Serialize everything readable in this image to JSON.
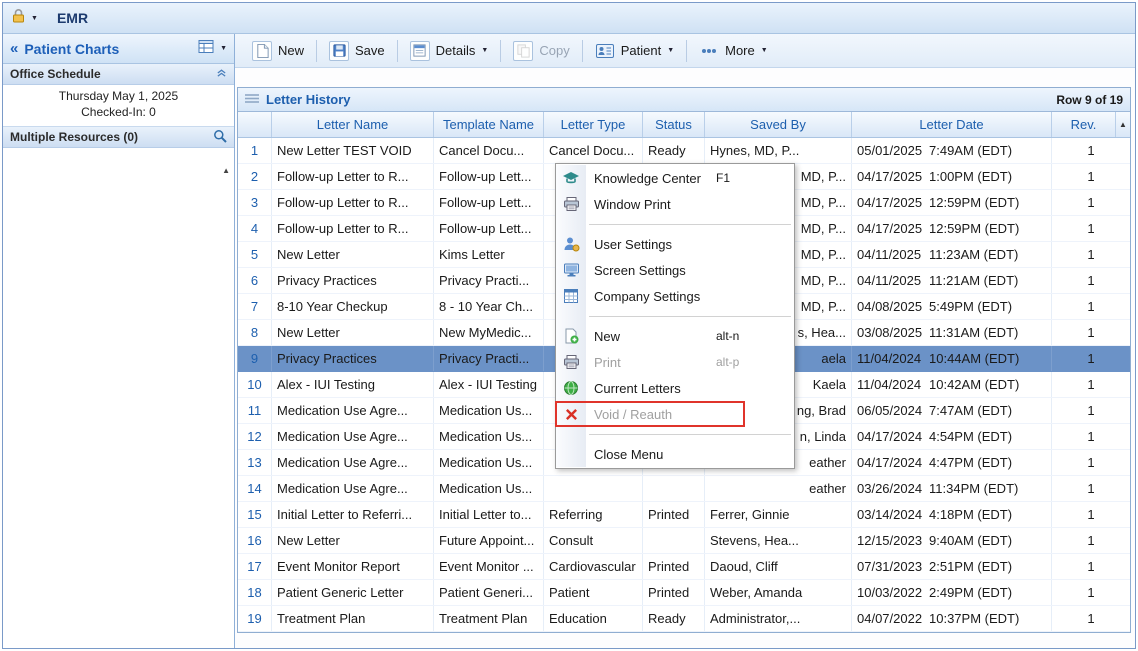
{
  "topbar": {
    "title": "EMR"
  },
  "sidebar": {
    "title": "Patient Charts",
    "office_schedule": {
      "header": "Office Schedule",
      "date": "Thursday May 1, 2025",
      "checked_in": "Checked-In: 0"
    },
    "resources": {
      "label": "Multiple Resources (0)"
    }
  },
  "toolbar": {
    "buttons": [
      {
        "label": "New",
        "icon": "new-doc-icon",
        "caret": false,
        "disabled": false
      },
      {
        "label": "Save",
        "icon": "save-icon",
        "caret": false,
        "disabled": false
      },
      {
        "label": "Details",
        "icon": "details-icon",
        "caret": true,
        "disabled": false
      },
      {
        "label": "Copy",
        "icon": "copy-icon",
        "caret": false,
        "disabled": true
      },
      {
        "label": "Patient",
        "icon": "patient-icon",
        "caret": true,
        "disabled": false
      },
      {
        "label": "More",
        "icon": "more-dots-icon",
        "caret": true,
        "disabled": false
      }
    ]
  },
  "letter_history": {
    "title": "Letter History",
    "row_status": "Row 9 of 19",
    "columns": [
      "",
      "Letter Name",
      "Template Name",
      "Letter Type",
      "Status",
      "Saved By",
      "Letter Date",
      "Rev."
    ],
    "rows": [
      {
        "num": "1",
        "letter_name": "New Letter TEST VOID",
        "template_name": "Cancel Docu...",
        "letter_type": "Cancel Docu...",
        "status": "Ready",
        "saved_by": "Hynes, MD, P...",
        "saved_by_covered": false,
        "letter_date": "05/01/2025 7:49AM (EDT)",
        "rev": "1",
        "selected": false
      },
      {
        "num": "2",
        "letter_name": "Follow-up Letter to R...",
        "template_name": "Follow-up Lett...",
        "letter_type": "",
        "status": "",
        "saved_by": "MD, P...",
        "saved_by_covered": true,
        "letter_date": "04/17/2025 1:00PM (EDT)",
        "rev": "1",
        "selected": false
      },
      {
        "num": "3",
        "letter_name": "Follow-up Letter to R...",
        "template_name": "Follow-up Lett...",
        "letter_type": "",
        "status": "",
        "saved_by": "MD, P...",
        "saved_by_covered": true,
        "letter_date": "04/17/2025 12:59PM (EDT)",
        "rev": "1",
        "selected": false
      },
      {
        "num": "4",
        "letter_name": "Follow-up Letter to R...",
        "template_name": "Follow-up Lett...",
        "letter_type": "",
        "status": "",
        "saved_by": "MD, P...",
        "saved_by_covered": true,
        "letter_date": "04/17/2025 12:59PM (EDT)",
        "rev": "1",
        "selected": false
      },
      {
        "num": "5",
        "letter_name": "New Letter",
        "template_name": "Kims Letter",
        "letter_type": "",
        "status": "",
        "saved_by": "MD, P...",
        "saved_by_covered": true,
        "letter_date": "04/11/2025 11:23AM (EDT)",
        "rev": "1",
        "selected": false
      },
      {
        "num": "6",
        "letter_name": "Privacy Practices",
        "template_name": "Privacy Practi...",
        "letter_type": "",
        "status": "",
        "saved_by": "MD, P...",
        "saved_by_covered": true,
        "letter_date": "04/11/2025 11:21AM (EDT)",
        "rev": "1",
        "selected": false
      },
      {
        "num": "7",
        "letter_name": "8-10 Year Checkup",
        "template_name": "8 - 10 Year Ch...",
        "letter_type": "",
        "status": "",
        "saved_by": "MD, P...",
        "saved_by_covered": true,
        "letter_date": "04/08/2025 5:49PM (EDT)",
        "rev": "1",
        "selected": false
      },
      {
        "num": "8",
        "letter_name": "New Letter",
        "template_name": "New MyMedic...",
        "letter_type": "",
        "status": "",
        "saved_by": "s, Hea...",
        "saved_by_covered": true,
        "letter_date": "03/08/2025 11:31AM (EDT)",
        "rev": "1",
        "selected": false
      },
      {
        "num": "9",
        "letter_name": "Privacy Practices",
        "template_name": "Privacy Practi...",
        "letter_type": "",
        "status": "",
        "saved_by": "aela",
        "saved_by_covered": true,
        "letter_date": "11/04/2024 10:44AM (EDT)",
        "rev": "1",
        "selected": true
      },
      {
        "num": "10",
        "letter_name": "Alex - IUI Testing",
        "template_name": "Alex - IUI Testing",
        "letter_type": "",
        "status": "",
        "saved_by": "Kaela",
        "saved_by_covered": true,
        "letter_date": "11/04/2024 10:42AM (EDT)",
        "rev": "1",
        "selected": false
      },
      {
        "num": "11",
        "letter_name": "Medication Use Agre...",
        "template_name": "Medication Us...",
        "letter_type": "",
        "status": "",
        "saved_by": "ng, Brad",
        "saved_by_covered": true,
        "letter_date": "06/05/2024 7:47AM (EDT)",
        "rev": "1",
        "selected": false
      },
      {
        "num": "12",
        "letter_name": "Medication Use Agre...",
        "template_name": "Medication Us...",
        "letter_type": "",
        "status": "",
        "saved_by": "n, Linda",
        "saved_by_covered": true,
        "letter_date": "04/17/2024 4:54PM (EDT)",
        "rev": "1",
        "selected": false
      },
      {
        "num": "13",
        "letter_name": "Medication Use Agre...",
        "template_name": "Medication Us...",
        "letter_type": "",
        "status": "",
        "saved_by": "eather",
        "saved_by_covered": true,
        "letter_date": "04/17/2024 4:47PM (EDT)",
        "rev": "1",
        "selected": false
      },
      {
        "num": "14",
        "letter_name": "Medication Use Agre...",
        "template_name": "Medication Us...",
        "letter_type": "",
        "status": "",
        "saved_by": "eather",
        "saved_by_covered": true,
        "letter_date": "03/26/2024 11:34PM (EDT)",
        "rev": "1",
        "selected": false
      },
      {
        "num": "15",
        "letter_name": "Initial Letter to Referri...",
        "template_name": "Initial Letter to...",
        "letter_type": "Referring",
        "status": "Printed",
        "saved_by": "Ferrer, Ginnie",
        "saved_by_covered": false,
        "letter_date": "03/14/2024 4:18PM (EDT)",
        "rev": "1",
        "selected": false
      },
      {
        "num": "16",
        "letter_name": "New Letter",
        "template_name": "Future Appoint...",
        "letter_type": "Consult",
        "status": "",
        "saved_by": "Stevens, Hea...",
        "saved_by_covered": false,
        "letter_date": "12/15/2023 9:40AM (EDT)",
        "rev": "1",
        "selected": false
      },
      {
        "num": "17",
        "letter_name": "Event Monitor Report",
        "template_name": "Event Monitor ...",
        "letter_type": "Cardiovascular",
        "status": "Printed",
        "saved_by": "Daoud, Cliff",
        "saved_by_covered": false,
        "letter_date": "07/31/2023 2:51PM (EDT)",
        "rev": "1",
        "selected": false
      },
      {
        "num": "18",
        "letter_name": "Patient Generic Letter",
        "template_name": "Patient Generi...",
        "letter_type": "Patient",
        "status": "Printed",
        "saved_by": "Weber, Amanda",
        "saved_by_covered": false,
        "letter_date": "10/03/2022 2:49PM (EDT)",
        "rev": "1",
        "selected": false
      },
      {
        "num": "19",
        "letter_name": "Treatment Plan",
        "template_name": "Treatment Plan",
        "letter_type": "Education",
        "status": "Ready",
        "saved_by": "Administrator,...",
        "saved_by_covered": false,
        "letter_date": "04/07/2022 10:37PM (EDT)",
        "rev": "1",
        "selected": false
      }
    ]
  },
  "context_menu": {
    "items": [
      {
        "type": "item",
        "label": "Knowledge Center",
        "icon": "knowledge-center-icon",
        "shortcut": "F1",
        "disabled": false,
        "highlighted": false
      },
      {
        "type": "item",
        "label": "Window Print",
        "icon": "printer-icon",
        "shortcut": "",
        "disabled": false,
        "highlighted": false
      },
      {
        "type": "separator"
      },
      {
        "type": "item",
        "label": "User Settings",
        "icon": "user-settings-icon",
        "shortcut": "",
        "disabled": false,
        "highlighted": false
      },
      {
        "type": "item",
        "label": "Screen Settings",
        "icon": "screen-settings-icon",
        "shortcut": "",
        "disabled": false,
        "highlighted": false
      },
      {
        "type": "item",
        "label": "Company Settings",
        "icon": "company-settings-icon",
        "shortcut": "",
        "disabled": false,
        "highlighted": false
      },
      {
        "type": "separator"
      },
      {
        "type": "item",
        "label": "New",
        "icon": "new-letter-icon",
        "shortcut": "alt-n",
        "disabled": false,
        "highlighted": false
      },
      {
        "type": "item",
        "label": "Print",
        "icon": "printer-icon",
        "shortcut": "alt-p",
        "disabled": true,
        "highlighted": false
      },
      {
        "type": "item",
        "label": "Current Letters",
        "icon": "current-letters-icon",
        "shortcut": "",
        "disabled": false,
        "highlighted": false
      },
      {
        "type": "item",
        "label": "Void / Reauth",
        "icon": "void-x-icon",
        "shortcut": "",
        "disabled": true,
        "highlighted": true
      },
      {
        "type": "separator"
      },
      {
        "type": "item",
        "label": "Close Menu",
        "icon": "",
        "shortcut": "",
        "disabled": false,
        "highlighted": false
      }
    ]
  },
  "colors": {
    "accent_blue": "#1d5fae",
    "selected_row": "#6b92c7",
    "highlight_red": "#e0342b",
    "disabled_text": "#a0a0a0"
  }
}
